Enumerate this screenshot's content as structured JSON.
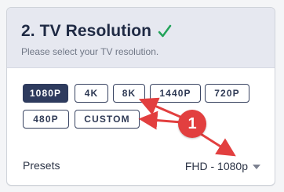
{
  "header": {
    "title": "2. TV Resolution",
    "subtitle": "Please select your TV resolution.",
    "check_icon": "check-icon"
  },
  "presets": {
    "buttons": [
      {
        "label": "1080P",
        "selected": true
      },
      {
        "label": "4K",
        "selected": false
      },
      {
        "label": "8K",
        "selected": false
      },
      {
        "label": "1440P",
        "selected": false
      },
      {
        "label": "720P",
        "selected": false
      },
      {
        "label": "480P",
        "selected": false
      },
      {
        "label": "CUSTOM",
        "selected": false
      }
    ],
    "footer_label": "Presets",
    "selected_value": "FHD - 1080p"
  },
  "annotation": {
    "number": "1"
  },
  "colors": {
    "accent": "#2e3b5e",
    "check": "#23a35a",
    "annotation": "#e23f3f"
  }
}
